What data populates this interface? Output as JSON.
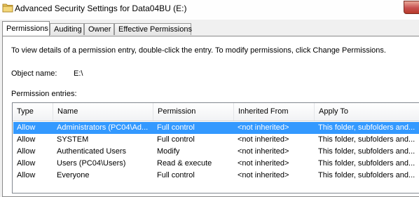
{
  "window": {
    "title": "Advanced Security Settings for Data04BU (E:)"
  },
  "tabs": [
    {
      "label": "Permissions",
      "active": true
    },
    {
      "label": "Auditing",
      "active": false
    },
    {
      "label": "Owner",
      "active": false
    },
    {
      "label": "Effective Permissions",
      "active": false
    }
  ],
  "permissions": {
    "hint": "To view details of a permission entry, double-click the entry. To modify permissions, click Change Permissions.",
    "object_name_label": "Object name:",
    "object_name_value": "E:\\",
    "entries_label": "Permission entries:",
    "columns": [
      "Type",
      "Name",
      "Permission",
      "Inherited From",
      "Apply To"
    ],
    "rows": [
      {
        "type": "Allow",
        "name": "Administrators (PC04\\Ad...",
        "permission": "Full control",
        "inherited": "<not inherited>",
        "apply": "This folder, subfolders and...",
        "selected": true
      },
      {
        "type": "Allow",
        "name": "SYSTEM",
        "permission": "Full control",
        "inherited": "<not inherited>",
        "apply": "This folder, subfolders and...",
        "selected": false
      },
      {
        "type": "Allow",
        "name": "Authenticated Users",
        "permission": "Modify",
        "inherited": "<not inherited>",
        "apply": "This folder, subfolders and...",
        "selected": false
      },
      {
        "type": "Allow",
        "name": "Users (PC04\\Users)",
        "permission": "Read & execute",
        "inherited": "<not inherited>",
        "apply": "This folder, subfolders and...",
        "selected": false
      },
      {
        "type": "Allow",
        "name": "Everyone",
        "permission": "Full control",
        "inherited": "<not inherited>",
        "apply": "This folder, subfolders and...",
        "selected": false
      }
    ]
  },
  "colors": {
    "selection": "#3399ff",
    "close_button": "#c75050"
  }
}
